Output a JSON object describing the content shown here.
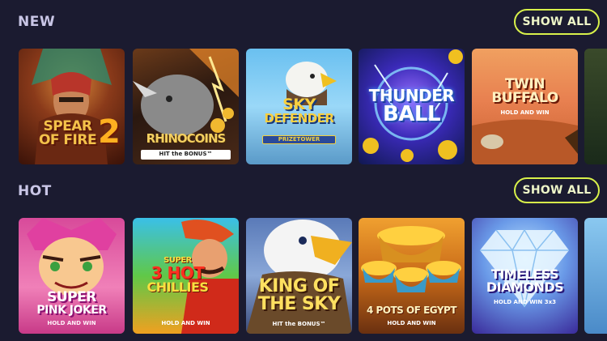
{
  "sections": [
    {
      "title": "NEW",
      "show_all_label": "SHOW ALL",
      "games": [
        {
          "title_line1": "SPEAR",
          "title_line2": "OF FIRE",
          "title_num": "2"
        },
        {
          "title": "RHINOCOINS",
          "subtitle": "HIT the BONUS™"
        },
        {
          "title_line1": "SKY",
          "title_line2": "DEFENDER",
          "subtitle": "PRIZETOWER"
        },
        {
          "title_line1": "THUNDER",
          "title_line2": "BALL"
        },
        {
          "title_line1": "TWIN",
          "title_line2": "BUFFALO",
          "subtitle": "HOLD AND WIN"
        }
      ]
    },
    {
      "title": "HOT",
      "show_all_label": "SHOW ALL",
      "games": [
        {
          "title_line1": "SUPER",
          "title_line2": "PINK JOKER",
          "subtitle": "HOLD AND WIN"
        },
        {
          "title_line0": "SUPER",
          "title_line1": "3 HOT",
          "title_line2": "CHILLIES",
          "subtitle": "HOLD AND WIN"
        },
        {
          "title_line1": "KING OF",
          "title_line2": "THE SKY",
          "subtitle": "HIT the BONUS™"
        },
        {
          "title_line1": "4 POTS OF EGYPT",
          "subtitle": "HOLD AND WIN"
        },
        {
          "title_line1": "TIMELESS",
          "title_line2": "DIAMONDS",
          "subtitle": "HOLD AND WIN 3x3"
        }
      ]
    }
  ],
  "colors": {
    "background": "#1b1b30",
    "accent": "#d8f14a",
    "section_title": "#c9c6e6"
  }
}
